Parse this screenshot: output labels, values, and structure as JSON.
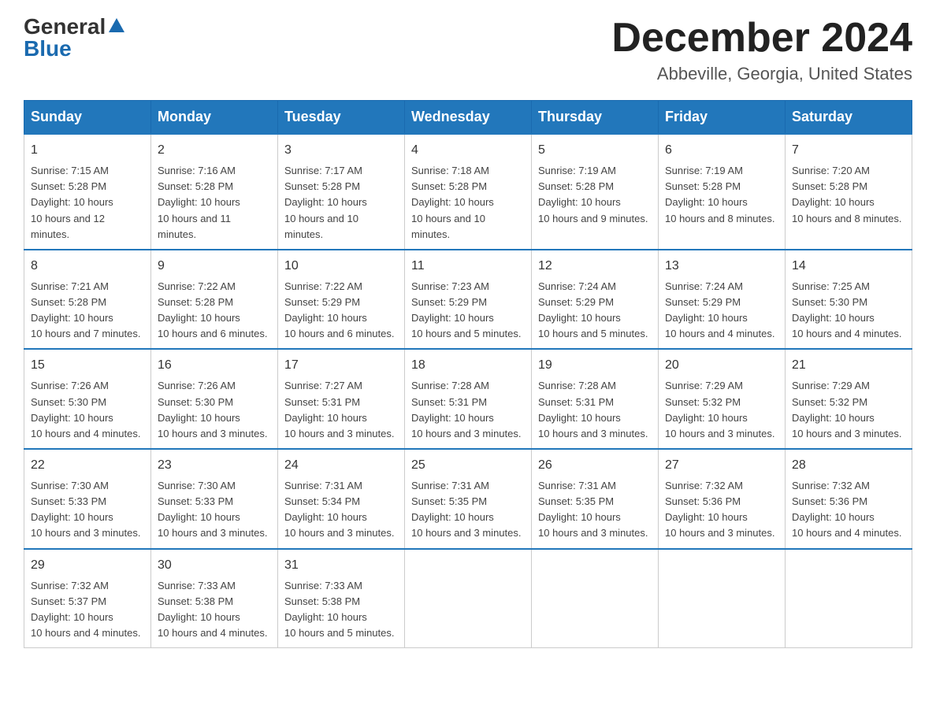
{
  "header": {
    "logo_general": "General",
    "logo_blue": "Blue",
    "month_title": "December 2024",
    "location": "Abbeville, Georgia, United States"
  },
  "days_of_week": [
    "Sunday",
    "Monday",
    "Tuesday",
    "Wednesday",
    "Thursday",
    "Friday",
    "Saturday"
  ],
  "weeks": [
    [
      {
        "day": "1",
        "sunrise": "7:15 AM",
        "sunset": "5:28 PM",
        "daylight": "10 hours and 12 minutes."
      },
      {
        "day": "2",
        "sunrise": "7:16 AM",
        "sunset": "5:28 PM",
        "daylight": "10 hours and 11 minutes."
      },
      {
        "day": "3",
        "sunrise": "7:17 AM",
        "sunset": "5:28 PM",
        "daylight": "10 hours and 10 minutes."
      },
      {
        "day": "4",
        "sunrise": "7:18 AM",
        "sunset": "5:28 PM",
        "daylight": "10 hours and 10 minutes."
      },
      {
        "day": "5",
        "sunrise": "7:19 AM",
        "sunset": "5:28 PM",
        "daylight": "10 hours and 9 minutes."
      },
      {
        "day": "6",
        "sunrise": "7:19 AM",
        "sunset": "5:28 PM",
        "daylight": "10 hours and 8 minutes."
      },
      {
        "day": "7",
        "sunrise": "7:20 AM",
        "sunset": "5:28 PM",
        "daylight": "10 hours and 8 minutes."
      }
    ],
    [
      {
        "day": "8",
        "sunrise": "7:21 AM",
        "sunset": "5:28 PM",
        "daylight": "10 hours and 7 minutes."
      },
      {
        "day": "9",
        "sunrise": "7:22 AM",
        "sunset": "5:28 PM",
        "daylight": "10 hours and 6 minutes."
      },
      {
        "day": "10",
        "sunrise": "7:22 AM",
        "sunset": "5:29 PM",
        "daylight": "10 hours and 6 minutes."
      },
      {
        "day": "11",
        "sunrise": "7:23 AM",
        "sunset": "5:29 PM",
        "daylight": "10 hours and 5 minutes."
      },
      {
        "day": "12",
        "sunrise": "7:24 AM",
        "sunset": "5:29 PM",
        "daylight": "10 hours and 5 minutes."
      },
      {
        "day": "13",
        "sunrise": "7:24 AM",
        "sunset": "5:29 PM",
        "daylight": "10 hours and 4 minutes."
      },
      {
        "day": "14",
        "sunrise": "7:25 AM",
        "sunset": "5:30 PM",
        "daylight": "10 hours and 4 minutes."
      }
    ],
    [
      {
        "day": "15",
        "sunrise": "7:26 AM",
        "sunset": "5:30 PM",
        "daylight": "10 hours and 4 minutes."
      },
      {
        "day": "16",
        "sunrise": "7:26 AM",
        "sunset": "5:30 PM",
        "daylight": "10 hours and 3 minutes."
      },
      {
        "day": "17",
        "sunrise": "7:27 AM",
        "sunset": "5:31 PM",
        "daylight": "10 hours and 3 minutes."
      },
      {
        "day": "18",
        "sunrise": "7:28 AM",
        "sunset": "5:31 PM",
        "daylight": "10 hours and 3 minutes."
      },
      {
        "day": "19",
        "sunrise": "7:28 AM",
        "sunset": "5:31 PM",
        "daylight": "10 hours and 3 minutes."
      },
      {
        "day": "20",
        "sunrise": "7:29 AM",
        "sunset": "5:32 PM",
        "daylight": "10 hours and 3 minutes."
      },
      {
        "day": "21",
        "sunrise": "7:29 AM",
        "sunset": "5:32 PM",
        "daylight": "10 hours and 3 minutes."
      }
    ],
    [
      {
        "day": "22",
        "sunrise": "7:30 AM",
        "sunset": "5:33 PM",
        "daylight": "10 hours and 3 minutes."
      },
      {
        "day": "23",
        "sunrise": "7:30 AM",
        "sunset": "5:33 PM",
        "daylight": "10 hours and 3 minutes."
      },
      {
        "day": "24",
        "sunrise": "7:31 AM",
        "sunset": "5:34 PM",
        "daylight": "10 hours and 3 minutes."
      },
      {
        "day": "25",
        "sunrise": "7:31 AM",
        "sunset": "5:35 PM",
        "daylight": "10 hours and 3 minutes."
      },
      {
        "day": "26",
        "sunrise": "7:31 AM",
        "sunset": "5:35 PM",
        "daylight": "10 hours and 3 minutes."
      },
      {
        "day": "27",
        "sunrise": "7:32 AM",
        "sunset": "5:36 PM",
        "daylight": "10 hours and 3 minutes."
      },
      {
        "day": "28",
        "sunrise": "7:32 AM",
        "sunset": "5:36 PM",
        "daylight": "10 hours and 4 minutes."
      }
    ],
    [
      {
        "day": "29",
        "sunrise": "7:32 AM",
        "sunset": "5:37 PM",
        "daylight": "10 hours and 4 minutes."
      },
      {
        "day": "30",
        "sunrise": "7:33 AM",
        "sunset": "5:38 PM",
        "daylight": "10 hours and 4 minutes."
      },
      {
        "day": "31",
        "sunrise": "7:33 AM",
        "sunset": "5:38 PM",
        "daylight": "10 hours and 5 minutes."
      },
      null,
      null,
      null,
      null
    ]
  ]
}
